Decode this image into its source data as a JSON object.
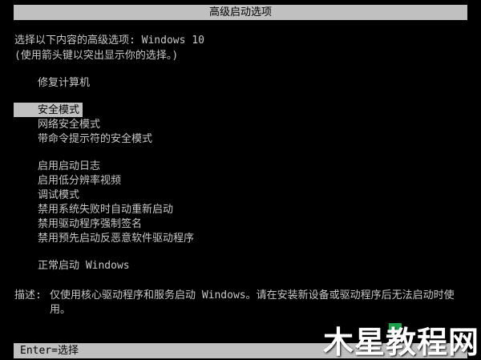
{
  "title": "高级启动选项",
  "intro": {
    "line1": "选择以下内容的高级选项: Windows 10",
    "line2": "(使用箭头键以突出显示你的选择。)"
  },
  "menu": {
    "repair": "修复计算机",
    "safe_mode": "安全模式",
    "safe_mode_network": "网络安全模式",
    "safe_mode_cmd": "带命令提示符的安全模式",
    "boot_logging": "启用启动日志",
    "low_res_video": "启用低分辨率视频",
    "debug_mode": "调试模式",
    "disable_auto_restart": "禁用系统失败时自动重新启动",
    "disable_driver_signature": "禁用驱动程序强制签名",
    "disable_elam": "禁用预先启动反恶意软件驱动程序",
    "normal_boot": "正常启动 Windows"
  },
  "selected_item": "safe_mode",
  "description": {
    "label": "描述:",
    "text": "仅使用核心驱动程序和服务启动 Windows。请在安装新设备或驱动程序后无法启动时使用。"
  },
  "footer": {
    "hint": "Enter=选择"
  },
  "watermark": {
    "text": "木星教程网"
  },
  "colors": {
    "background": "#000000",
    "text": "#c8c8c8",
    "highlight_bar": "#c0c0c0",
    "watermark_accent": "#1aa34a"
  }
}
